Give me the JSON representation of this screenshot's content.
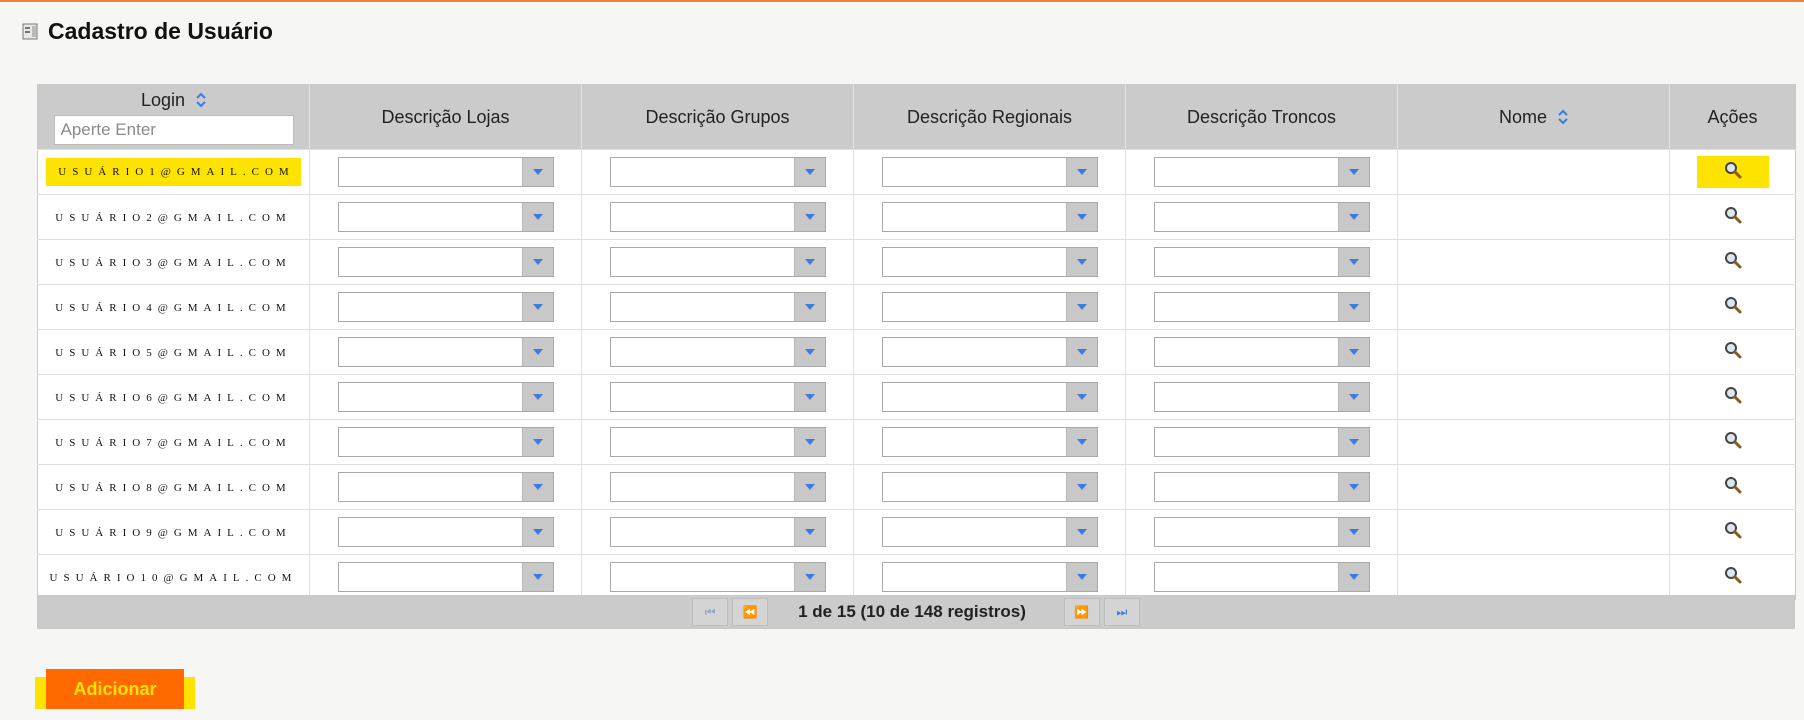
{
  "header": {
    "title": "Cadastro de Usuário",
    "icon": "document-icon"
  },
  "table": {
    "columns": {
      "login": "Login",
      "lojas": "Descrição Lojas",
      "grupos": "Descrição Grupos",
      "regionais": "Descrição Regionais",
      "troncos": "Descrição Troncos",
      "nome": "Nome",
      "acoes": "Ações"
    },
    "filter_placeholder": "Aperte Enter",
    "rows": [
      {
        "login": "usuário1@gmail.com"
      },
      {
        "login": "usuário2@gmail.com"
      },
      {
        "login": "usuário3@gmail.com"
      },
      {
        "login": "usuário4@gmail.com"
      },
      {
        "login": "usuário5@gmail.com"
      },
      {
        "login": "usuário6@gmail.com"
      },
      {
        "login": "usuário7@gmail.com"
      },
      {
        "login": "usuário8@gmail.com"
      },
      {
        "login": "usuário9@gmail.com"
      },
      {
        "login": "usuário10@gmail.com"
      }
    ],
    "action_icon": "magnifier-icon"
  },
  "pager": {
    "text": "1 de 15 (10 de 148 registros)"
  },
  "add_button": "Adicionar",
  "colors": {
    "accent": "#ff6a00",
    "highlight": "#ffe300",
    "header_bg": "#cbcbcb",
    "top_line": "#e8853a"
  }
}
